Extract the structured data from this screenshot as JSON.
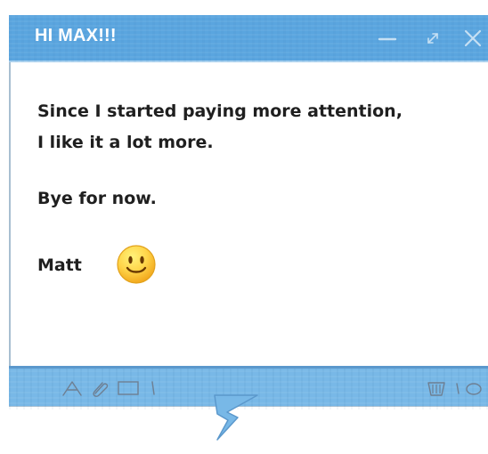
{
  "window": {
    "title": "HI MAX!!!"
  },
  "controls": {
    "minimize_icon": "minimize-icon",
    "expand_icon": "expand-icon",
    "close_icon": "close-icon"
  },
  "message": {
    "line_1": "Since I started paying more attention,",
    "line_2": "I like it a lot more.",
    "line_3": "Bye for now.",
    "signature": "Matt",
    "emoji": "smiley-face"
  },
  "toolbar": {
    "icons": [
      "text-format-icon",
      "attachment-icon",
      "image-icon",
      "divider-icon",
      "delete-icon",
      "more-icon"
    ]
  },
  "colors": {
    "header_blue": "#5aa5df",
    "toolbar_blue": "#78b8e7",
    "text": "#1f1f1f",
    "smiley_yellow": "#ffd54a"
  }
}
